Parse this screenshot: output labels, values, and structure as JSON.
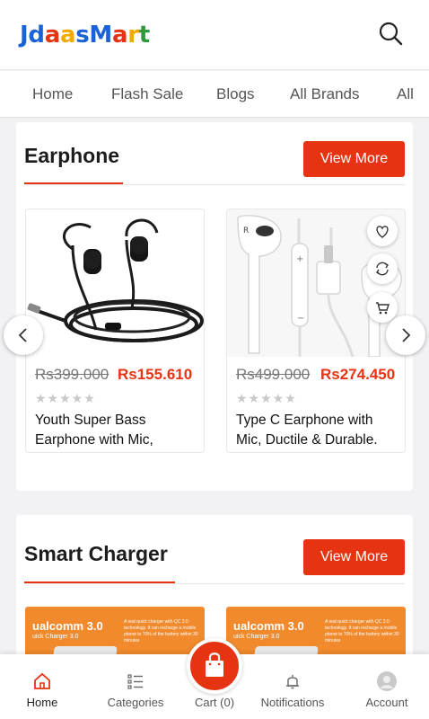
{
  "header": {
    "logo_letters": [
      {
        "ch": "J",
        "color": "#1a63d6"
      },
      {
        "ch": "d",
        "color": "#1a63d6"
      },
      {
        "ch": "a",
        "color": "#e63312"
      },
      {
        "ch": "a",
        "color": "#f2a900"
      },
      {
        "ch": "s",
        "color": "#1a63d6"
      },
      {
        "ch": "M",
        "color": "#1a63d6"
      },
      {
        "ch": "a",
        "color": "#e63312"
      },
      {
        "ch": "r",
        "color": "#f2a900"
      },
      {
        "ch": "t",
        "color": "#2d9a3e"
      }
    ],
    "search_icon": "search-icon"
  },
  "nav": {
    "items": [
      "Home",
      "Flash Sale",
      "Blogs",
      "All Brands",
      "All"
    ]
  },
  "earphone": {
    "title": "Earphone",
    "view_more": "View More",
    "products": [
      {
        "old_price": "Rs399.000",
        "new_price": "Rs155.610",
        "stars": "★★★★★",
        "name": "Youth Super Bass Earphone with Mic,"
      },
      {
        "old_price": "Rs499.000",
        "new_price": "Rs274.450",
        "stars": "★★★★★",
        "name": "Type C Earphone with Mic, Ductile & Durable."
      }
    ]
  },
  "charger": {
    "title": "Smart Charger",
    "view_more": "View More",
    "qc_label": "ualcomm 3.0",
    "qc_sub": "uick Charger 3.0",
    "promo_text": "A real quick charger with QC 3.0 technology. It can recharge a mobile phone to 70% of the battery within 30 minutes"
  },
  "bottom_nav": {
    "items": [
      "Home",
      "Categories",
      "Cart (0)",
      "Notifications",
      "Account"
    ],
    "active": "Home"
  },
  "colors": {
    "accent": "#e63312",
    "active_tab": "#e63312"
  }
}
